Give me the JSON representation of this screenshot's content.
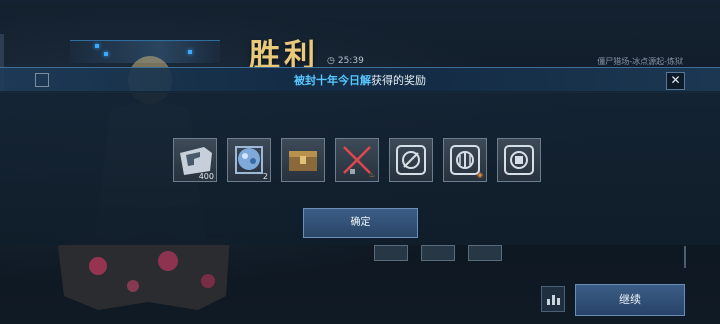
{
  "result": {
    "title": "胜利",
    "time": "25:39",
    "mission_path": "僵尸猎场-冰点源起-炼狱"
  },
  "reward_panel": {
    "title_highlight": "被封十年今日解",
    "title_suffix": "获得的奖励",
    "close_symbol": "✕",
    "items": [
      {
        "icon": "card-icon",
        "count": "400"
      },
      {
        "icon": "crystal-cube-icon",
        "count": "2"
      },
      {
        "icon": "treasure-box-icon",
        "count": ""
      },
      {
        "icon": "crossed-lightsabers-icon",
        "count": ""
      },
      {
        "icon": "badge-dagger-icon",
        "count": ""
      },
      {
        "icon": "badge-shield-icon",
        "count": ""
      },
      {
        "icon": "badge-fist-icon",
        "count": ""
      }
    ],
    "confirm_label": "确定"
  },
  "footer": {
    "continue_label": "继续"
  },
  "colors": {
    "accent_blue": "#58c7ff",
    "victory_gold": "#e9c97a",
    "button_blue": "#3a5d85"
  }
}
